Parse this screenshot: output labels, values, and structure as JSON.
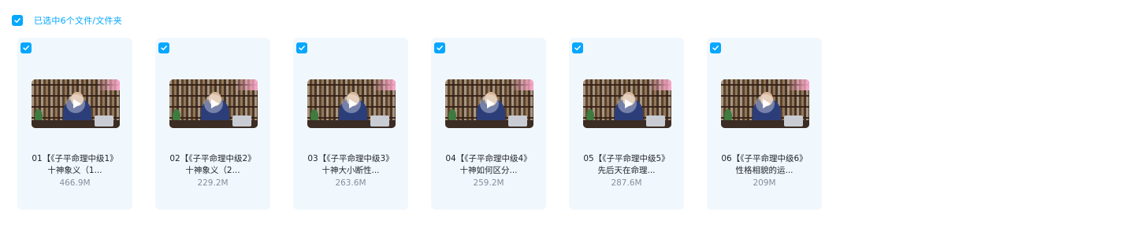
{
  "header": {
    "selection_text": "已选中6个文件/文件夹"
  },
  "colors": {
    "accent": "#06a7ff",
    "card_bg": "#f1f8fd",
    "title_text": "#1f2329",
    "size_text": "#878c9c"
  },
  "files": [
    {
      "line1": "01【《子平命理中级1》",
      "line2": "十神象义（1...",
      "size": "466.9M",
      "checked": true,
      "icon": "video-thumbnail"
    },
    {
      "line1": "02【《子平命理中级2》",
      "line2": "十神象义（2...",
      "size": "229.2M",
      "checked": true,
      "icon": "video-thumbnail"
    },
    {
      "line1": "03【《子平命理中级3》",
      "line2": "十神大小断性...",
      "size": "263.6M",
      "checked": true,
      "icon": "video-thumbnail"
    },
    {
      "line1": "04【《子平命理中级4》",
      "line2": "十神如何区分...",
      "size": "259.2M",
      "checked": true,
      "icon": "video-thumbnail"
    },
    {
      "line1": "05【《子平命理中级5》",
      "line2": "先后天在命理...",
      "size": "287.6M",
      "checked": true,
      "icon": "video-thumbnail"
    },
    {
      "line1": "06【《子平命理中级6》",
      "line2": "性格相貌的运...",
      "size": "209M",
      "checked": true,
      "icon": "video-thumbnail"
    }
  ]
}
